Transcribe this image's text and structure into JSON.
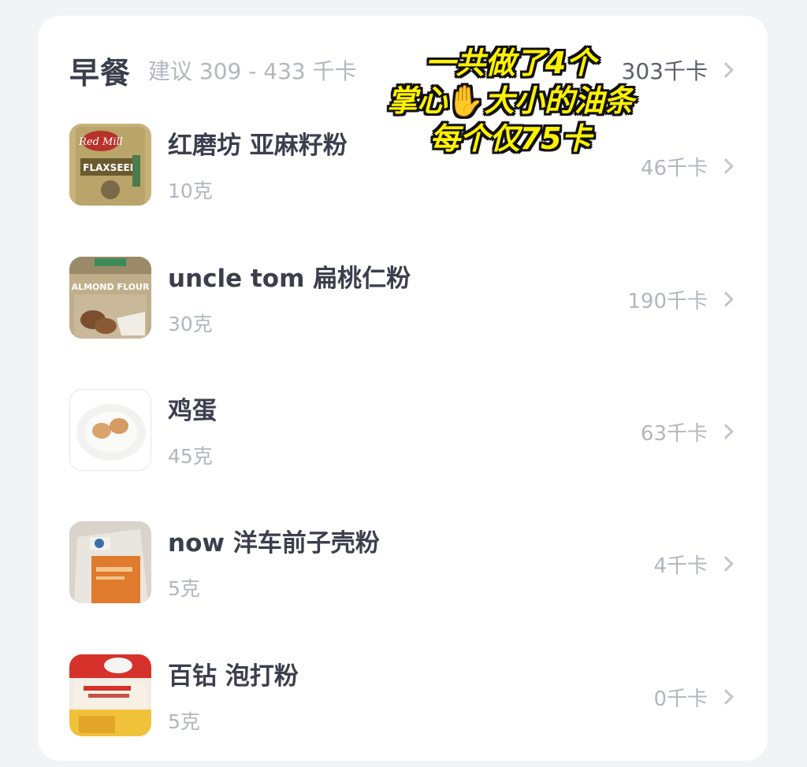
{
  "meal": {
    "title": "早餐",
    "suggestion": "建议 309 - 433 千卡",
    "total": "303千卡"
  },
  "overlay": {
    "line1": "一共做了4个",
    "line2_a": "掌心",
    "line2_icon": "✋",
    "line2_b": "大小的油条",
    "line3": "每个仅75卡"
  },
  "items": [
    {
      "name": "红磨坊 亚麻籽粉",
      "amount": "10克",
      "kcal": "46千卡",
      "icon": "flaxseed-meal-bag-photo"
    },
    {
      "name": "uncle tom 扁桃仁粉",
      "amount": "30克",
      "kcal": "190千卡",
      "icon": "almond-flour-bag-photo"
    },
    {
      "name": "鸡蛋",
      "amount": "45克",
      "kcal": "63千卡",
      "icon": "eggs-on-plate-photo"
    },
    {
      "name": "now 洋车前子壳粉",
      "amount": "5克",
      "kcal": "4千卡",
      "icon": "psyllium-husk-bag-photo"
    },
    {
      "name": "百钻 泡打粉",
      "amount": "5克",
      "kcal": "0千卡",
      "icon": "baking-powder-package-photo"
    }
  ]
}
